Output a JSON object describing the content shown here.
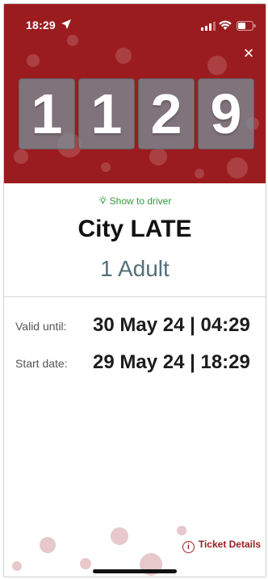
{
  "status_bar": {
    "time": "18:29",
    "icons": [
      "location-arrow-icon",
      "signal-icon",
      "wifi-icon",
      "battery-icon"
    ]
  },
  "header": {
    "close_label": "×",
    "code_digits": [
      "1",
      "1",
      "2",
      "9"
    ],
    "colors": {
      "background": "#9b1c1f",
      "tile": "#788c96"
    }
  },
  "ticket": {
    "show_to_driver": "Show to driver",
    "name": "City LATE",
    "passenger": "1 Adult",
    "accent": "#2f9d3a"
  },
  "details": [
    {
      "label": "Valid until:",
      "value": "30 May 24 | 04:29"
    },
    {
      "label": "Start date:",
      "value": "29 May 24 | 18:29"
    }
  ],
  "footer": {
    "ticket_details": "Ticket Details",
    "info_icon": "info-icon"
  }
}
